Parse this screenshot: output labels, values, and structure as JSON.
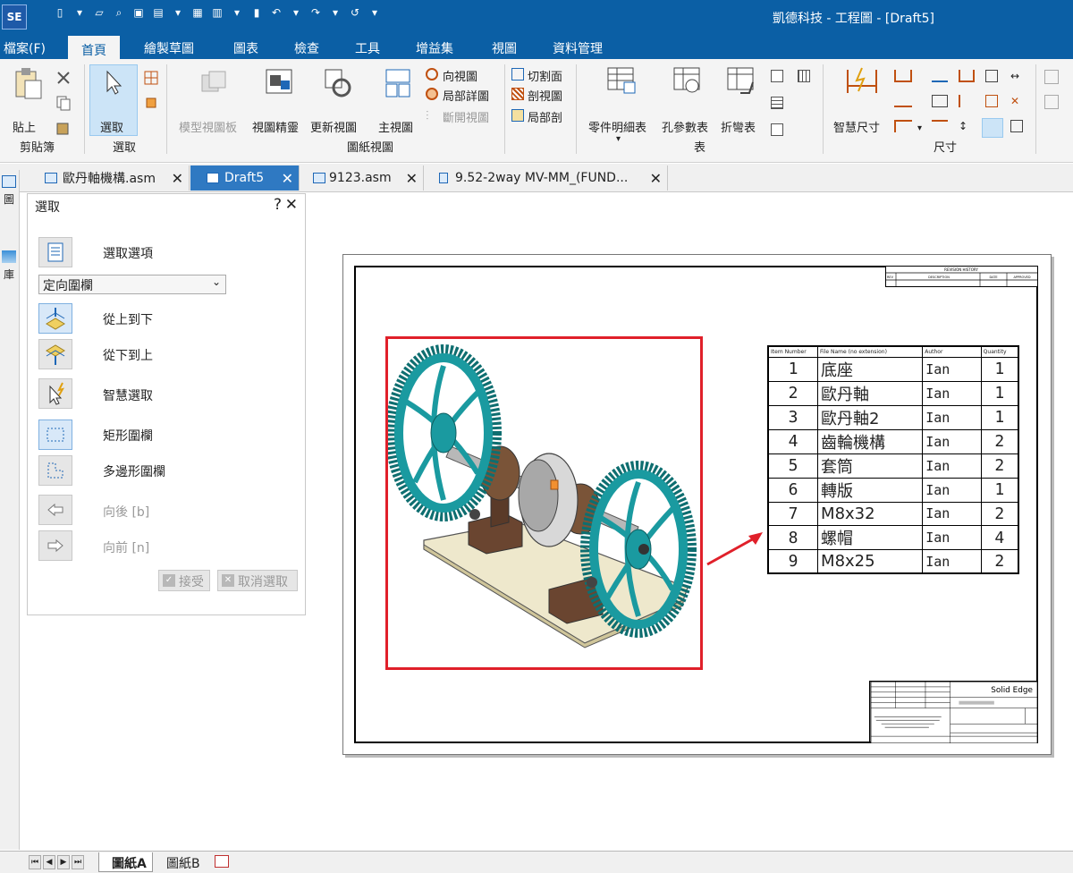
{
  "app": {
    "logo": "SE",
    "window_title": "凱德科技 - 工程圖 - [Draft5]"
  },
  "menu": {
    "file": "檔案(F)",
    "tabs": [
      "首頁",
      "繪製草圖",
      "圖表",
      "檢查",
      "工具",
      "增益集",
      "視圖",
      "資料管理"
    ],
    "active_tab": "首頁"
  },
  "ribbon": {
    "clipboard": {
      "paste": "貼上",
      "group": "剪貼簿"
    },
    "select": {
      "select": "選取",
      "group": "選取"
    },
    "drawing_views": {
      "model_view_board": "模型視圖板",
      "view_wizard": "視圖精靈",
      "update_view": "更新視圖",
      "principal_view": "主視圖",
      "aux_view": "向視圖",
      "detail_view": "局部詳圖",
      "broken_view": "斷開視圖",
      "cutting_plane": "切割面",
      "section_view": "剖視圖",
      "broken_out": "局部剖",
      "group": "圖紙視圖"
    },
    "tables": {
      "parts_list": "零件明細表",
      "hole_table": "孔參數表",
      "bend_table": "折彎表",
      "group": "表"
    },
    "dimension": {
      "smart_dimension": "智慧尺寸",
      "group": "尺寸"
    }
  },
  "doc_tabs": [
    {
      "label": "歐丹軸機構.asm",
      "active": false
    },
    {
      "label": "Draft5",
      "active": true
    },
    {
      "label": "9123.asm",
      "active": false
    },
    {
      "label": "9.52-2way MV-MM_(FUND...",
      "active": false
    }
  ],
  "left_strip": {
    "label_top": "圖",
    "label_bottom": "庫"
  },
  "panel": {
    "title": "選取",
    "help": "?",
    "close": "✕",
    "select_options": "選取選項",
    "dropdown_value": "定向圍欄",
    "top_down": "從上到下",
    "bottom_up": "從下到上",
    "smart_select": "智慧選取",
    "rect_fence": "矩形圍欄",
    "poly_fence": "多邊形圍欄",
    "back": "向後 [b]",
    "forward": "向前 [n]",
    "accept": "接受",
    "deselect": "取消選取"
  },
  "drawing": {
    "revision": {
      "title": "REVISION HISTORY",
      "headers": [
        "REV",
        "DESCRIPTION",
        "DATE",
        "APPROVED"
      ]
    },
    "bom": {
      "headers": [
        "Item Number",
        "File Name (no extension)",
        "Author",
        "Quantity"
      ],
      "rows": [
        {
          "item": "1",
          "name": "底座",
          "author": "Ian",
          "qty": "1"
        },
        {
          "item": "2",
          "name": "歐丹軸",
          "author": "Ian",
          "qty": "1"
        },
        {
          "item": "3",
          "name": "歐丹軸2",
          "author": "Ian",
          "qty": "1"
        },
        {
          "item": "4",
          "name": "齒輪機構",
          "author": "Ian",
          "qty": "2"
        },
        {
          "item": "5",
          "name": "套筒",
          "author": "Ian",
          "qty": "2"
        },
        {
          "item": "6",
          "name": "轉版",
          "author": "Ian",
          "qty": "1"
        },
        {
          "item": "7",
          "name": "M8x32",
          "author": "Ian",
          "qty": "2"
        },
        {
          "item": "8",
          "name": "螺帽",
          "author": "Ian",
          "qty": "4"
        },
        {
          "item": "9",
          "name": "M8x25",
          "author": "Ian",
          "qty": "2"
        }
      ]
    },
    "titleblock": {
      "brand": "Solid Edge"
    }
  },
  "sheet_tabs": [
    {
      "label": "圖紙A",
      "active": true
    },
    {
      "label": "圖紙B",
      "active": false
    }
  ],
  "colors": {
    "accent": "#0b5fa5",
    "highlight": "#e0202a",
    "gear": "#1a9aa0"
  }
}
